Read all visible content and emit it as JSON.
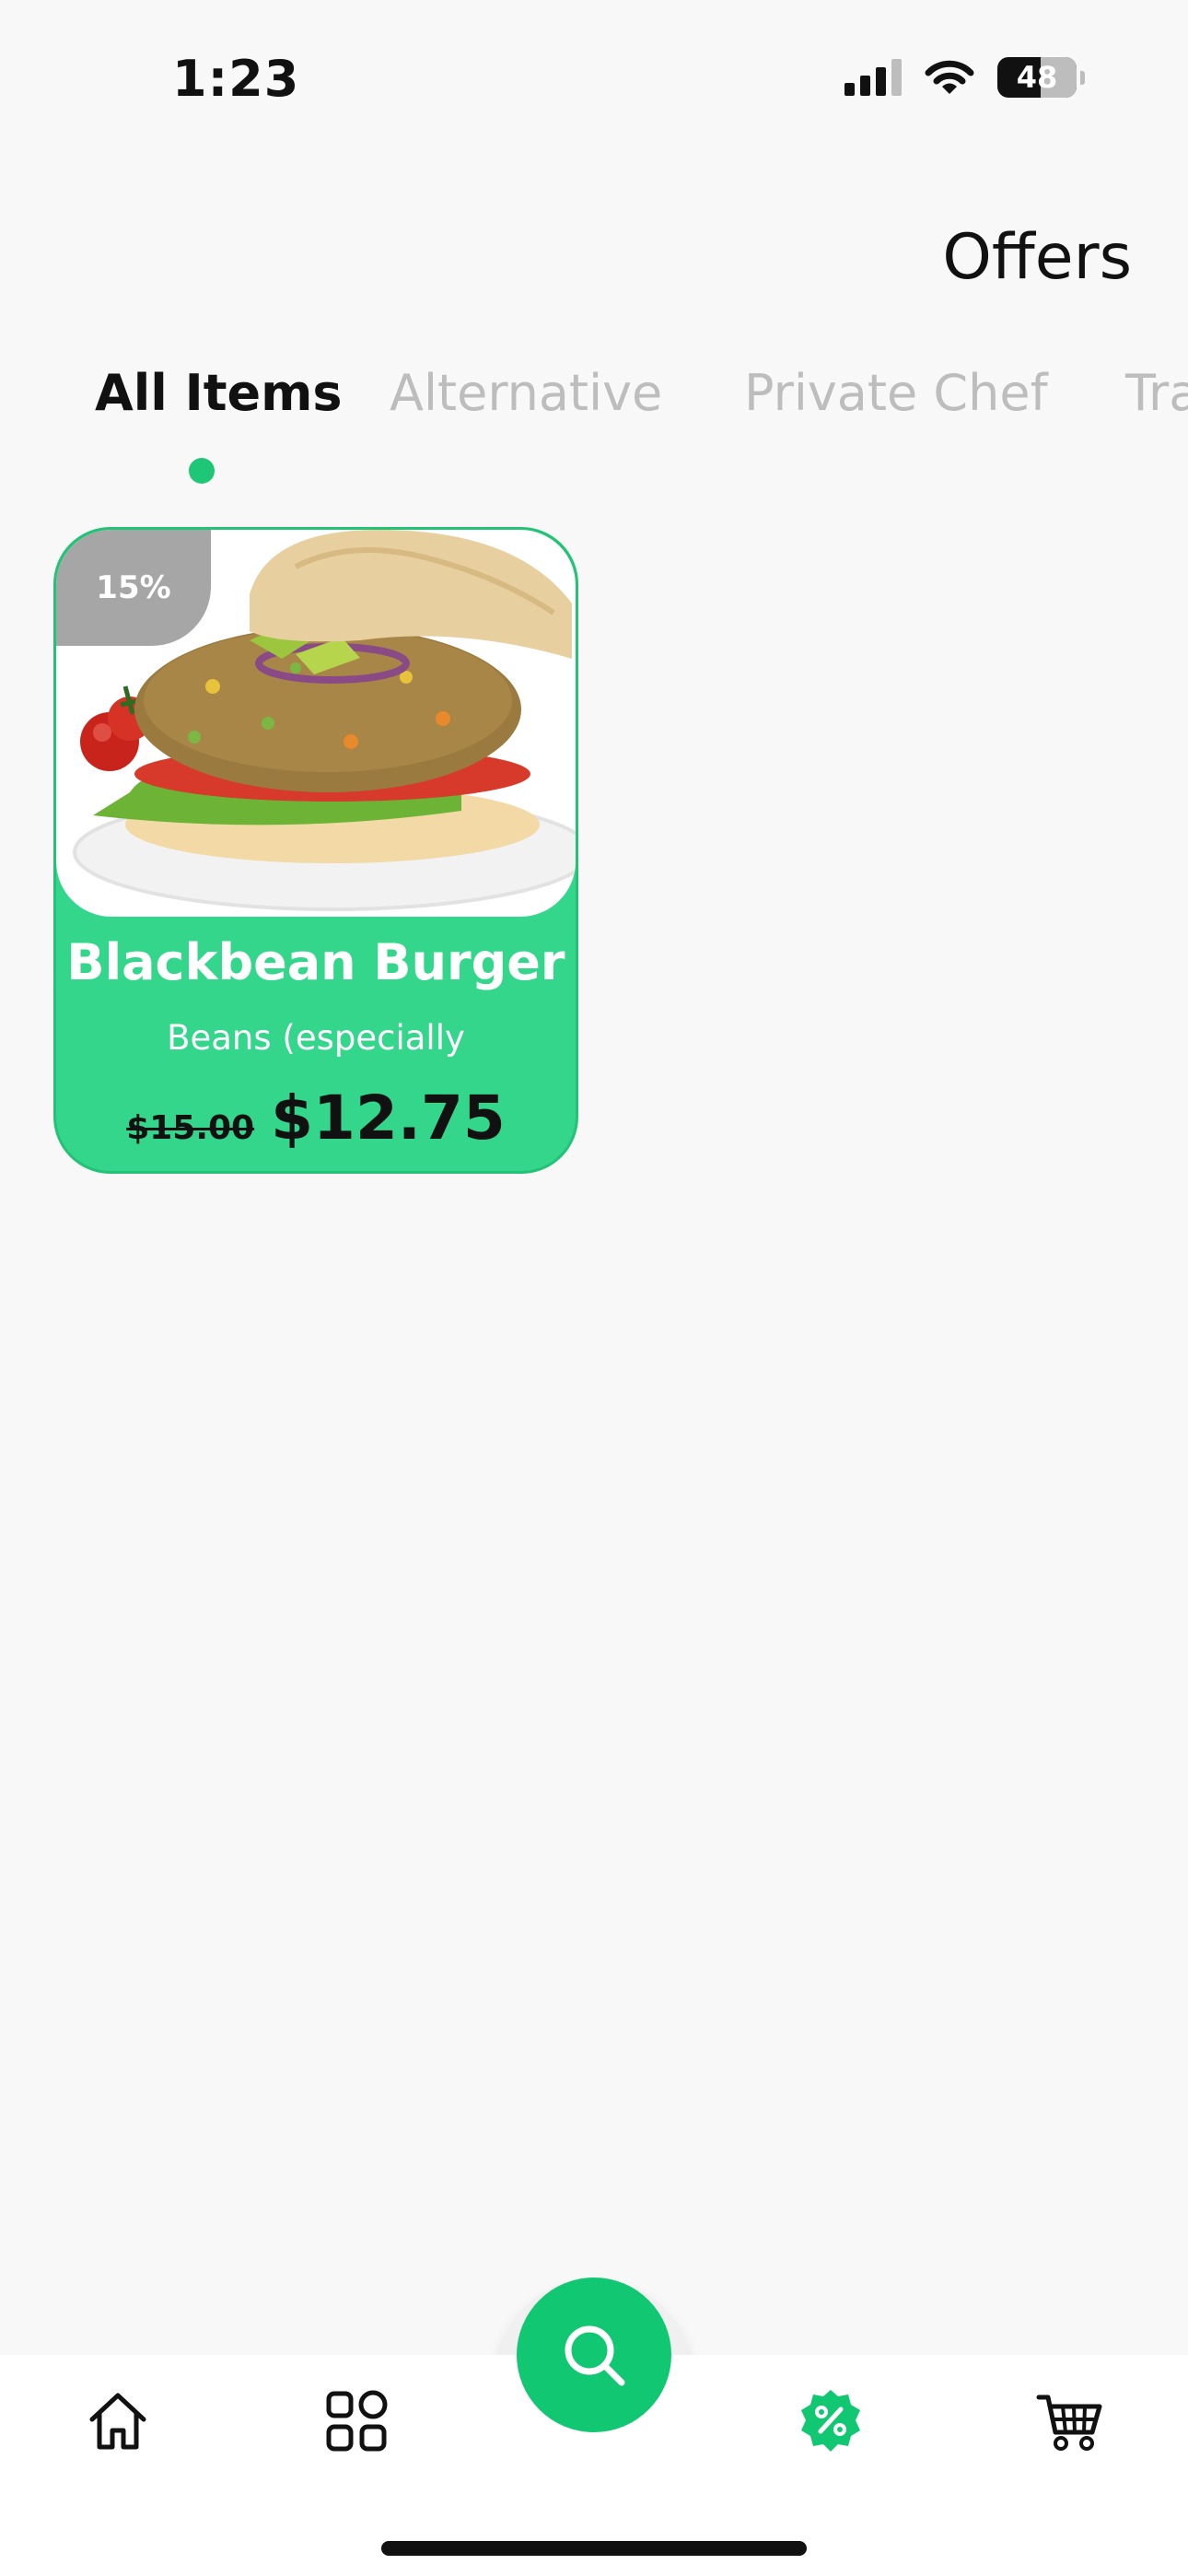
{
  "status": {
    "time": "1:23",
    "battery": "48"
  },
  "header": {
    "title": "Offers"
  },
  "tabs": [
    {
      "label": "All Items",
      "active": true
    },
    {
      "label": "Alternative",
      "active": false
    },
    {
      "label": "Private Chef",
      "active": false
    },
    {
      "label": "Tra",
      "active": false
    }
  ],
  "offers": [
    {
      "discount": "15%",
      "title": "Blackbean Burger",
      "description": "Beans (especially",
      "old_price": "$15.00",
      "new_price": "$12.75"
    }
  ],
  "bottom_nav": {
    "items": [
      {
        "icon": "home-icon"
      },
      {
        "icon": "grid-icon"
      },
      {
        "icon": "search-icon"
      },
      {
        "icon": "discount-icon",
        "active": true
      },
      {
        "icon": "cart-icon"
      }
    ]
  },
  "colors": {
    "accent": "#12c772",
    "card": "#33d68a",
    "inactive_tab": "#bdbdbd"
  }
}
